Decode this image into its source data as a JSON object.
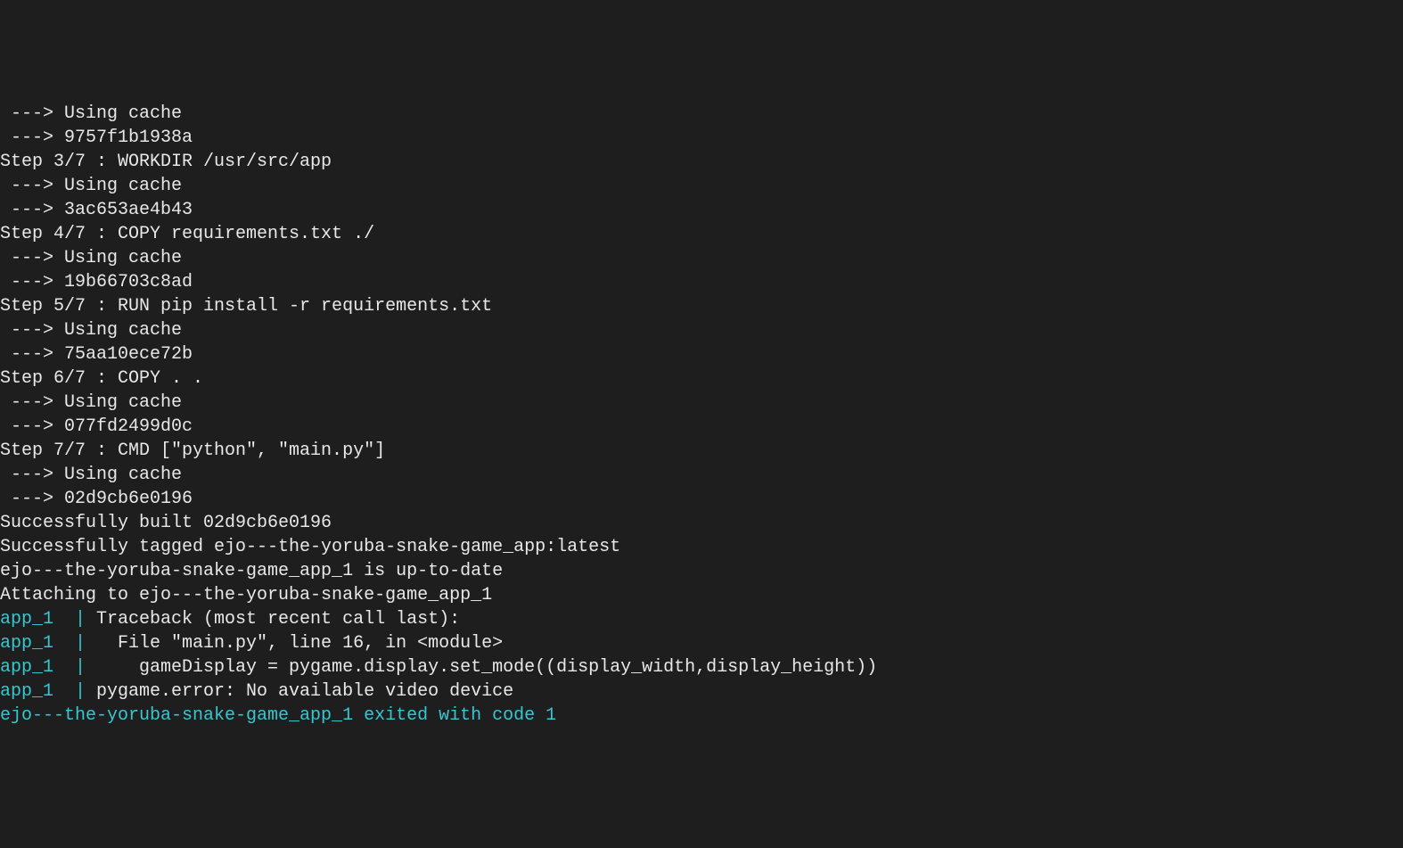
{
  "terminal": {
    "lines": [
      {
        "segments": [
          {
            "text": " ---> Using cache"
          }
        ]
      },
      {
        "segments": [
          {
            "text": " ---> 9757f1b1938a"
          }
        ]
      },
      {
        "segments": [
          {
            "text": "Step 3/7 : WORKDIR /usr/src/app"
          }
        ]
      },
      {
        "segments": [
          {
            "text": " ---> Using cache"
          }
        ]
      },
      {
        "segments": [
          {
            "text": " ---> 3ac653ae4b43"
          }
        ]
      },
      {
        "segments": [
          {
            "text": "Step 4/7 : COPY requirements.txt ./"
          }
        ]
      },
      {
        "segments": [
          {
            "text": " ---> Using cache"
          }
        ]
      },
      {
        "segments": [
          {
            "text": " ---> 19b66703c8ad"
          }
        ]
      },
      {
        "segments": [
          {
            "text": "Step 5/7 : RUN pip install -r requirements.txt"
          }
        ]
      },
      {
        "segments": [
          {
            "text": " ---> Using cache"
          }
        ]
      },
      {
        "segments": [
          {
            "text": " ---> 75aa10ece72b"
          }
        ]
      },
      {
        "segments": [
          {
            "text": "Step 6/7 : COPY . ."
          }
        ]
      },
      {
        "segments": [
          {
            "text": " ---> Using cache"
          }
        ]
      },
      {
        "segments": [
          {
            "text": " ---> 077fd2499d0c"
          }
        ]
      },
      {
        "segments": [
          {
            "text": "Step 7/7 : CMD [\"python\", \"main.py\"]"
          }
        ]
      },
      {
        "segments": [
          {
            "text": " ---> Using cache"
          }
        ]
      },
      {
        "segments": [
          {
            "text": " ---> 02d9cb6e0196"
          }
        ]
      },
      {
        "segments": [
          {
            "text": "Successfully built 02d9cb6e0196"
          }
        ]
      },
      {
        "segments": [
          {
            "text": "Successfully tagged ejo---the-yoruba-snake-game_app:latest"
          }
        ]
      },
      {
        "segments": [
          {
            "text": "ejo---the-yoruba-snake-game_app_1 is up-to-date"
          }
        ]
      },
      {
        "segments": [
          {
            "text": "Attaching to ejo---the-yoruba-snake-game_app_1"
          }
        ]
      },
      {
        "segments": [
          {
            "text": "app_1  |",
            "cls": "cyan"
          },
          {
            "text": " Traceback (most recent call last):"
          }
        ]
      },
      {
        "segments": [
          {
            "text": "app_1  |",
            "cls": "cyan"
          },
          {
            "text": "   File \"main.py\", line 16, in <module>"
          }
        ]
      },
      {
        "segments": [
          {
            "text": "app_1  |",
            "cls": "cyan"
          },
          {
            "text": "     gameDisplay = pygame.display.set_mode((display_width,display_height))"
          }
        ]
      },
      {
        "segments": [
          {
            "text": "app_1  |",
            "cls": "cyan"
          },
          {
            "text": " pygame.error: No available video device"
          }
        ]
      },
      {
        "segments": [
          {
            "text": "ejo---the-yoruba-snake-game_app_1 exited with code 1",
            "cls": "cyan"
          }
        ]
      }
    ]
  }
}
